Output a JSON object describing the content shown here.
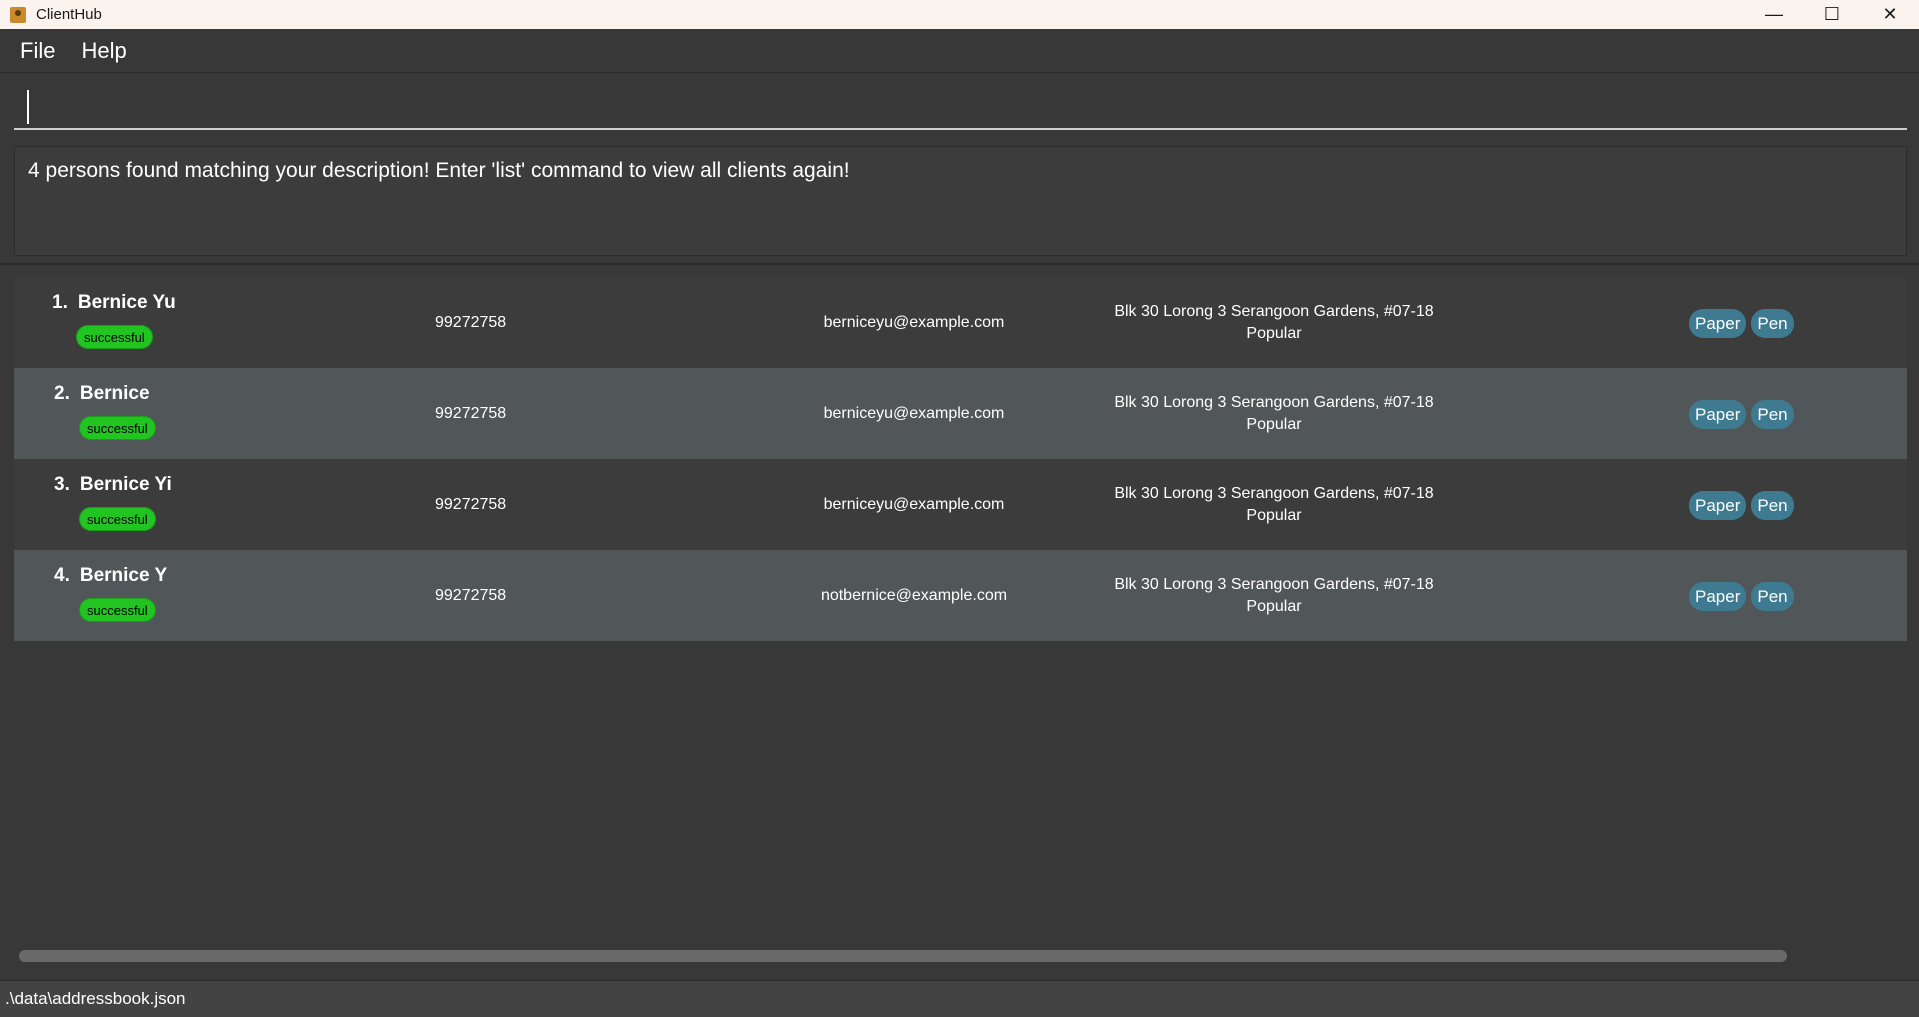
{
  "window": {
    "title": "ClientHub",
    "minimize_glyph": "—",
    "maximize_glyph": "☐",
    "close_glyph": "✕"
  },
  "menu": {
    "items": [
      {
        "label": "File"
      },
      {
        "label": "Help"
      }
    ]
  },
  "command": {
    "value": "",
    "placeholder": ""
  },
  "result": {
    "message": "4 persons found matching your description! Enter 'list' command to view all clients again!"
  },
  "persons": [
    {
      "index": "1.",
      "name": "Bernice Yu",
      "status": "successful",
      "phone": "99272758",
      "email": "berniceyu@example.com",
      "address": "Blk 30 Lorong 3 Serangoon Gardens, #07-18",
      "remark": "Popular",
      "tags": [
        "Paper",
        "Pen"
      ]
    },
    {
      "index": "2.",
      "name": "Bernice",
      "status": "successful",
      "phone": "99272758",
      "email": "berniceyu@example.com",
      "address": "Blk 30 Lorong 3 Serangoon Gardens, #07-18",
      "remark": "Popular",
      "tags": [
        "Paper",
        "Pen"
      ]
    },
    {
      "index": "3.",
      "name": "Bernice Yi",
      "status": "successful",
      "phone": "99272758",
      "email": "berniceyu@example.com",
      "address": "Blk 30 Lorong 3 Serangoon Gardens, #07-18",
      "remark": "Popular",
      "tags": [
        "Paper",
        "Pen"
      ]
    },
    {
      "index": "4.",
      "name": "Bernice Y",
      "status": "successful",
      "phone": "99272758",
      "email": "notbernice@example.com",
      "address": "Blk 30 Lorong 3 Serangoon Gardens, #07-18",
      "remark": "Popular",
      "tags": [
        "Paper",
        "Pen"
      ]
    }
  ],
  "statusbar": {
    "path": ".\\data\\addressbook.json"
  },
  "colors": {
    "status_successful": "#22c422",
    "tag_bg": "#3e7b91",
    "row_odd": "#3c3c3c",
    "row_even": "#515658"
  },
  "icons": {
    "app": "address-book-icon"
  }
}
